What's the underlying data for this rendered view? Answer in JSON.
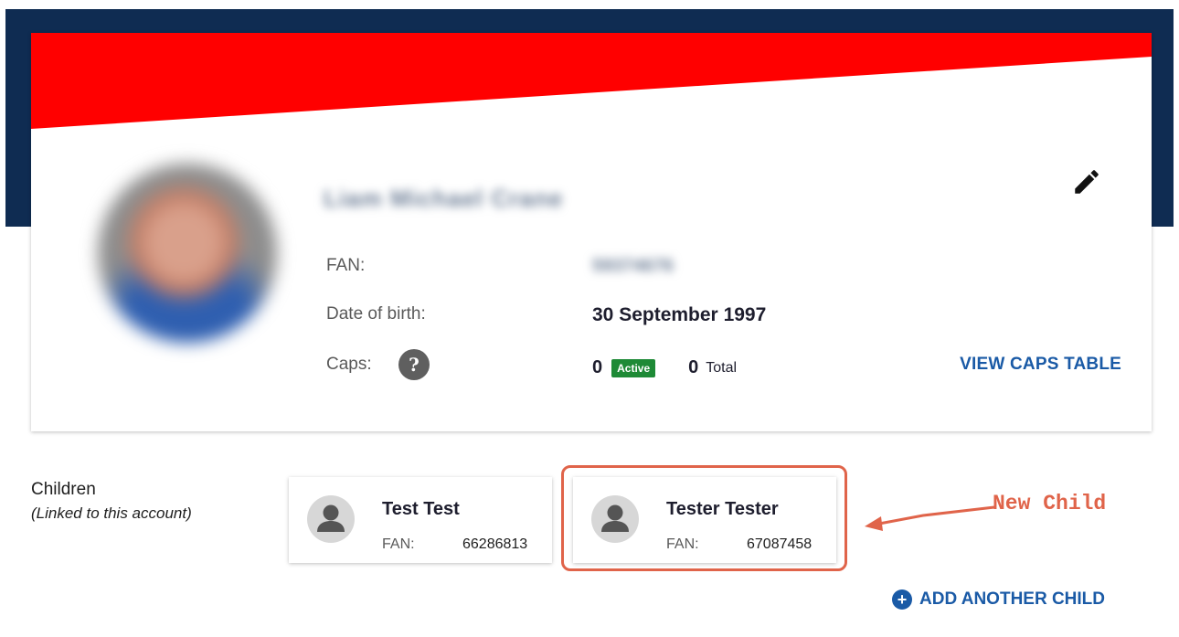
{
  "profile": {
    "name": "Liam Michael Crane",
    "fan_label": "FAN:",
    "fan_value": "59374676",
    "dob_label": "Date of birth:",
    "dob_value": "30 September 1997",
    "caps_label": "Caps:",
    "help_icon_glyph": "?",
    "active_caps": "0",
    "active_label": "Active",
    "total_caps": "0",
    "total_label": "Total",
    "view_caps_label": "VIEW CAPS TABLE",
    "edit_icon": "pencil-icon"
  },
  "children": {
    "title": "Children",
    "subtitle": "(Linked to this account)",
    "items": [
      {
        "name": "Test Test",
        "fan_label": "FAN:",
        "fan_value": "66286813"
      },
      {
        "name": "Tester Tester",
        "fan_label": "FAN:",
        "fan_value": "67087458"
      }
    ],
    "add_label": "ADD ANOTHER CHILD",
    "add_icon_glyph": "+"
  },
  "annotation": {
    "text": "New Child"
  },
  "colors": {
    "navy": "#0f2c52",
    "red": "#ff0000",
    "link_blue": "#1a5aa6",
    "active_green": "#1e8a36",
    "annotation": "#e0644a"
  }
}
